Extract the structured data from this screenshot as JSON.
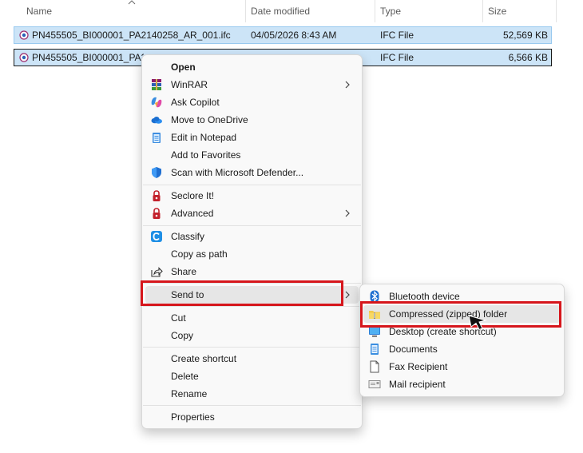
{
  "columns": {
    "name": "Name",
    "date": "Date modified",
    "type": "Type",
    "size": "Size"
  },
  "files": [
    {
      "name": "PN455505_BI000001_PA2140258_AR_001.ifc",
      "date": "04/05/2026 8:43 AM",
      "type": "IFC File",
      "size": "52,569 KB"
    },
    {
      "name": "PN455505_BI000001_PA214",
      "date": "",
      "type": "IFC File",
      "size": "6,566 KB"
    }
  ],
  "context_menu": {
    "open": "Open",
    "winrar": "WinRAR",
    "ask_copilot": "Ask Copilot",
    "move_onedrive": "Move to OneDrive",
    "edit_notepad": "Edit in Notepad",
    "add_favorites": "Add to Favorites",
    "scan_defender": "Scan with Microsoft Defender...",
    "seclore": "Seclore It!",
    "advanced": "Advanced",
    "classify": "Classify",
    "copy_path": "Copy as path",
    "share": "Share",
    "send_to": "Send to",
    "cut": "Cut",
    "copy": "Copy",
    "create_shortcut": "Create shortcut",
    "delete": "Delete",
    "rename": "Rename",
    "properties": "Properties"
  },
  "send_to_menu": {
    "bluetooth": "Bluetooth device",
    "compressed": "Compressed (zipped) folder",
    "desktop": "Desktop (create shortcut)",
    "documents": "Documents",
    "fax": "Fax Recipient",
    "mail": "Mail recipient"
  },
  "colors": {
    "selection": "#cce4f7",
    "highlight_box": "#d6161c",
    "hover": "#e6e6e6"
  }
}
